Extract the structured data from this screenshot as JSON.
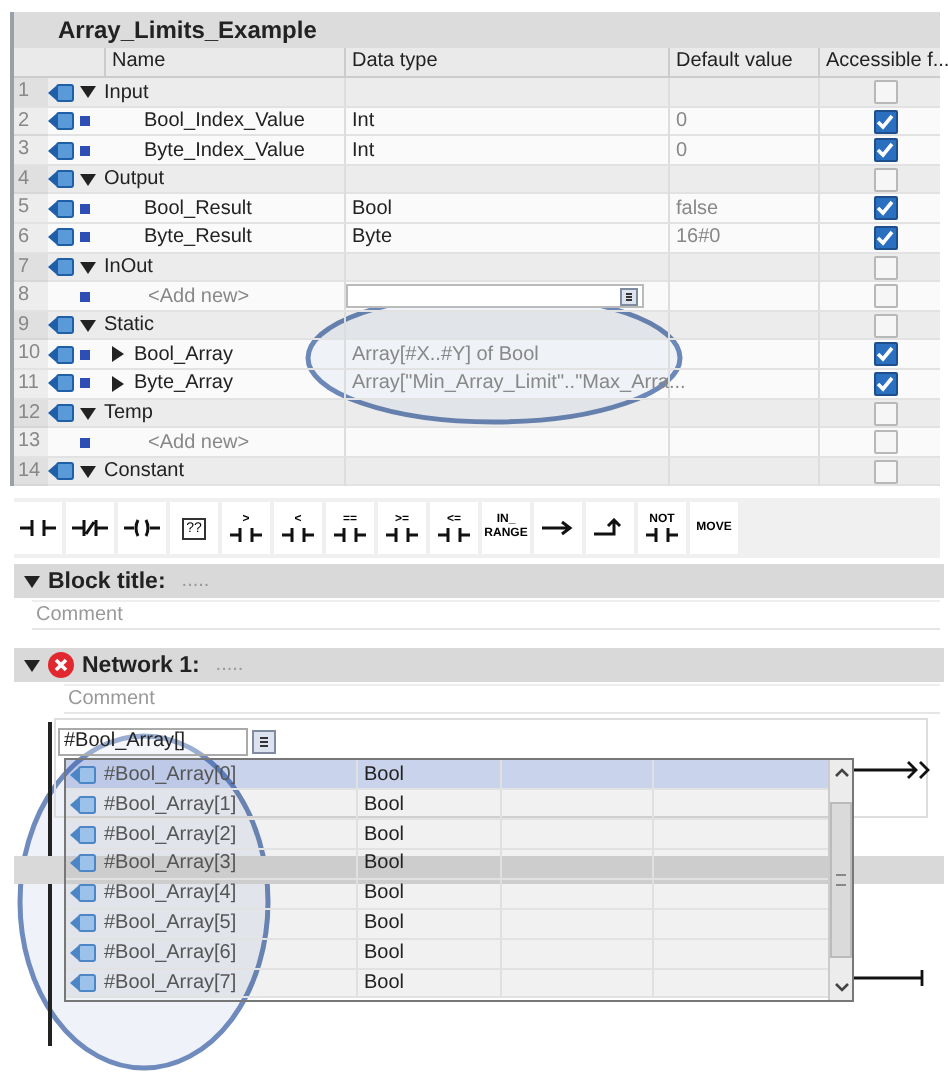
{
  "block": {
    "title": "Array_Limits_Example",
    "columns": [
      "Name",
      "Data type",
      "Default value",
      "Accessible f..."
    ],
    "rows": [
      {
        "num": "1",
        "kind": "section",
        "name": "Input",
        "expanded": true,
        "accessible": false
      },
      {
        "num": "2",
        "kind": "item",
        "name": "Bool_Index_Value",
        "data_type": "Int",
        "default": "0",
        "accessible": true
      },
      {
        "num": "3",
        "kind": "item",
        "name": "Byte_Index_Value",
        "data_type": "Int",
        "default": "0",
        "accessible": true
      },
      {
        "num": "4",
        "kind": "section",
        "name": "Output",
        "expanded": true,
        "accessible": false
      },
      {
        "num": "5",
        "kind": "item",
        "name": "Bool_Result",
        "data_type": "Bool",
        "default": "false",
        "accessible": true
      },
      {
        "num": "6",
        "kind": "item",
        "name": "Byte_Result",
        "data_type": "Byte",
        "default": "16#0",
        "accessible": true
      },
      {
        "num": "7",
        "kind": "section",
        "name": "InOut",
        "expanded": true,
        "accessible": false
      },
      {
        "num": "8",
        "kind": "add",
        "name": "<Add new>",
        "type_field": true,
        "accessible": false
      },
      {
        "num": "9",
        "kind": "section",
        "name": "Static",
        "expanded": true,
        "accessible": false
      },
      {
        "num": "10",
        "kind": "array",
        "name": "Bool_Array",
        "expanded": false,
        "data_type": "Array[#X..#Y] of Bool",
        "accessible": true
      },
      {
        "num": "11",
        "kind": "array",
        "name": "Byte_Array",
        "expanded": false,
        "data_type": "Array[\"Min_Array_Limit\"..\"Max_Arra...",
        "accessible": true
      },
      {
        "num": "12",
        "kind": "section",
        "name": "Temp",
        "expanded": true,
        "accessible": false
      },
      {
        "num": "13",
        "kind": "add",
        "name": "<Add new>",
        "type_field": false,
        "accessible": false
      },
      {
        "num": "14",
        "kind": "section",
        "name": "Constant",
        "expanded": true,
        "accessible": false
      }
    ]
  },
  "toolbar": [
    {
      "kind": "contact"
    },
    {
      "kind": "nc_contact"
    },
    {
      "kind": "coil"
    },
    {
      "kind": "box",
      "label": "??"
    },
    {
      "kind": "compare",
      "label": ">"
    },
    {
      "kind": "compare",
      "label": "<"
    },
    {
      "kind": "compare",
      "label": "=="
    },
    {
      "kind": "compare",
      "label": ">="
    },
    {
      "kind": "compare",
      "label": "<="
    },
    {
      "kind": "text",
      "label": "IN_ RANGE"
    },
    {
      "kind": "branch_open"
    },
    {
      "kind": "branch_close"
    },
    {
      "kind": "compare",
      "label": "NOT"
    },
    {
      "kind": "text",
      "label": "MOVE"
    }
  ],
  "block_title": {
    "label": "Block title:",
    "value": ".....",
    "comment": "Comment",
    "expanded": true
  },
  "network": {
    "label": "Network 1:",
    "value": ".....",
    "comment": "Comment",
    "expanded": true,
    "error": true,
    "operand": "#Bool_Array[]",
    "list": [
      {
        "name": "#Bool_Array[0]",
        "type": "Bool",
        "selected": true
      },
      {
        "name": "#Bool_Array[1]",
        "type": "Bool",
        "selected": false
      },
      {
        "name": "#Bool_Array[2]",
        "type": "Bool",
        "selected": false
      },
      {
        "name": "#Bool_Array[3]",
        "type": "Bool",
        "selected": false
      },
      {
        "name": "#Bool_Array[4]",
        "type": "Bool",
        "selected": false
      },
      {
        "name": "#Bool_Array[5]",
        "type": "Bool",
        "selected": false
      },
      {
        "name": "#Bool_Array[6]",
        "type": "Bool",
        "selected": false
      },
      {
        "name": "#Bool_Array[7]",
        "type": "Bool",
        "selected": false
      }
    ]
  }
}
